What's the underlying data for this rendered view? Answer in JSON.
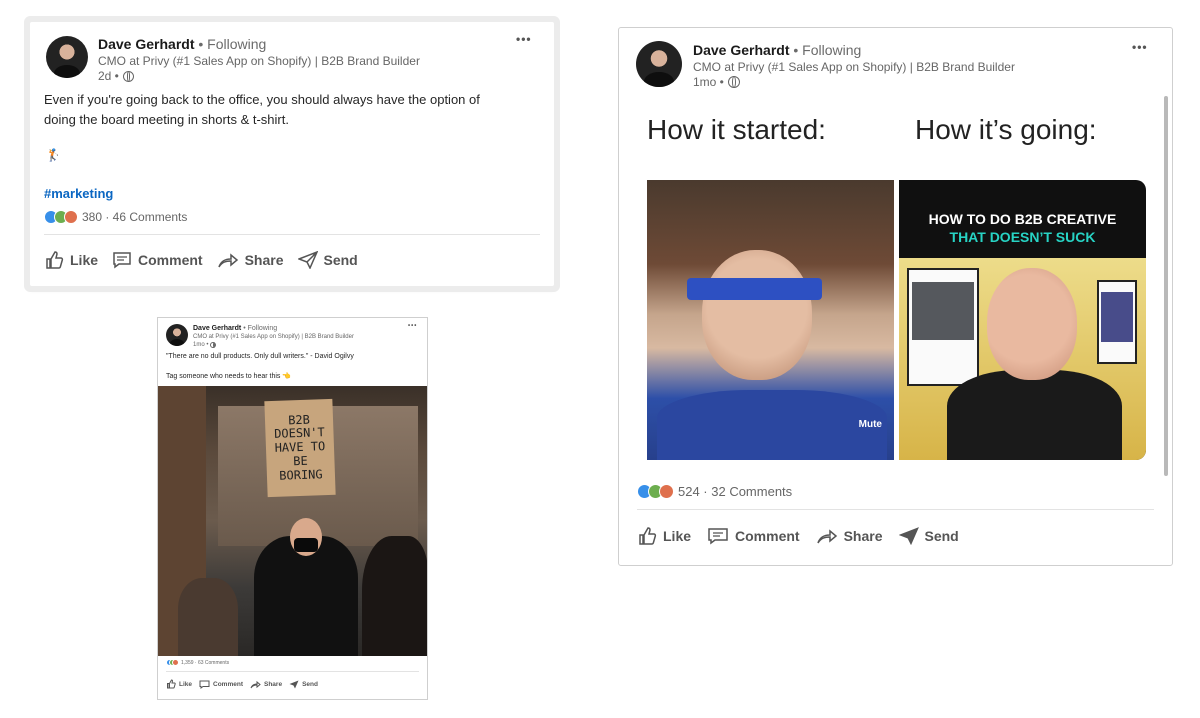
{
  "post_a": {
    "author": "Dave Gerhardt",
    "follow": "• Following",
    "headline": "CMO at Privy (#1 Sales App on Shopify) | B2B Brand Builder",
    "time": "2d •",
    "more": "•••",
    "text_line1": "Even if you're going back to the office, you should always have the option of",
    "text_line2": "doing the board meeting in shorts & t-shirt.",
    "emoji": "🏌️",
    "hashtag": "#marketing",
    "reactions": "380 · 46 Comments",
    "actions": {
      "like": "Like",
      "comment": "Comment",
      "share": "Share",
      "send": "Send"
    }
  },
  "post_b": {
    "author": "Dave Gerhardt",
    "follow": "• Following",
    "headline": "CMO at Privy (#1 Sales App on Shopify) | B2B Brand Builder",
    "time": "1mo •",
    "more": "•••",
    "heading_left": "How it started:",
    "heading_right": "How it’s going:",
    "gif_label": "Mute",
    "card_title_1": "HOW TO DO B2B CREATIVE",
    "card_title_2": "THAT DOESN’T SUCK",
    "reactions": "524 · 32 Comments",
    "actions": {
      "like": "Like",
      "comment": "Comment",
      "share": "Share",
      "send": "Send"
    },
    "colors": {
      "card_accent": "#27d3c4",
      "card_white": "#ffffff"
    }
  },
  "post_c": {
    "author": "Dave Gerhardt",
    "follow": "• Following",
    "headline": "CMO at Privy (#1 Sales App on Shopify) | B2B Brand Builder",
    "time": "1mo •",
    "more": "•••",
    "quote": "\"There are no dull products. Only dull writers.\" - David Ogilvy",
    "tag_line": "Tag someone who needs to hear this 👈",
    "sign_lines": [
      "B2B",
      "DOESN'T",
      "HAVE TO",
      "BE",
      "BORING"
    ],
    "reactions": "1,359 · 63 Comments",
    "actions": {
      "like": "Like",
      "comment": "Comment",
      "share": "Share",
      "send": "Send"
    }
  },
  "colors": {
    "link": "#0a66c2",
    "like": "#378fe9",
    "clap": "#6dae4f",
    "love": "#df704d"
  }
}
